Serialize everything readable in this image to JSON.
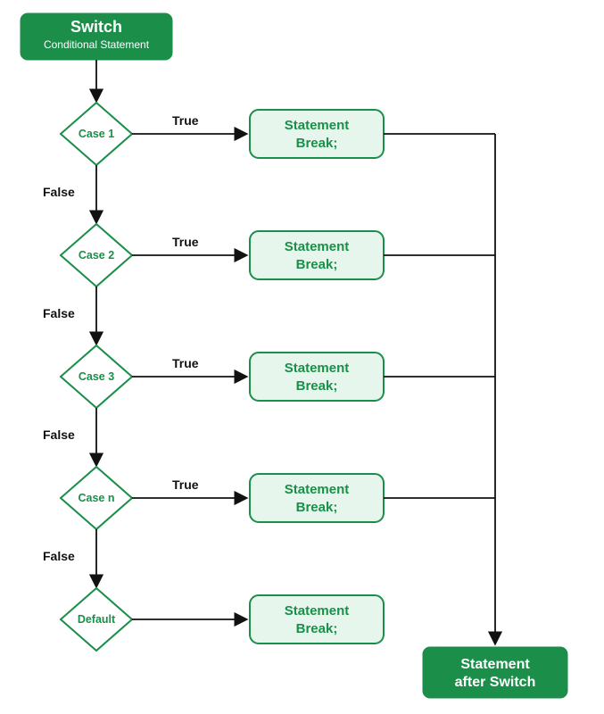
{
  "chart_data": {
    "type": "flowchart",
    "title": "",
    "start": {
      "title": "Switch",
      "subtitle": "Conditional Statement"
    },
    "cases": [
      {
        "label": "Case 1",
        "statement_line1": "Statement",
        "statement_line2": "Break;"
      },
      {
        "label": "Case 2",
        "statement_line1": "Statement",
        "statement_line2": "Break;"
      },
      {
        "label": "Case 3",
        "statement_line1": "Statement",
        "statement_line2": "Break;"
      },
      {
        "label": "Case n",
        "statement_line1": "Statement",
        "statement_line2": "Break;"
      }
    ],
    "default": {
      "label": "Default",
      "statement_line1": "Statement",
      "statement_line2": "Break;"
    },
    "edge_labels": {
      "true": "True",
      "false": "False"
    },
    "end": {
      "line1": "Statement",
      "line2": "after Switch"
    }
  }
}
